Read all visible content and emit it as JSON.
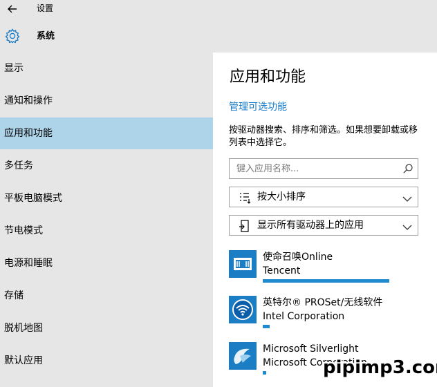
{
  "header": {
    "back_icon": "back-arrow-icon",
    "app_title": "设置",
    "section_icon": "gear-icon",
    "section_title": "系统"
  },
  "sidebar": {
    "selected_index": 2,
    "items": [
      {
        "label": "显示"
      },
      {
        "label": "通知和操作"
      },
      {
        "label": "应用和功能"
      },
      {
        "label": "多任务"
      },
      {
        "label": "平板电脑模式"
      },
      {
        "label": "节电模式"
      },
      {
        "label": "电源和睡眠"
      },
      {
        "label": "存储"
      },
      {
        "label": "脱机地图"
      },
      {
        "label": "默认应用"
      }
    ]
  },
  "main": {
    "title": "应用和功能",
    "manage_link": "管理可选功能",
    "description_line1": "按驱动器搜索、排序和筛选。如果想要卸载或移",
    "description_line2": "列表中选择它。",
    "search": {
      "placeholder": "键入应用名称..."
    },
    "sort": {
      "label": "按大小排序"
    },
    "filter": {
      "label": "显示所有驱动器上的应用"
    },
    "accent_color": "#1278c8",
    "apps": [
      {
        "name": "使命召唤Online",
        "publisher": "Tencent",
        "size_fraction": 1.0
      },
      {
        "name": "英特尔® PROSet/无线软件",
        "publisher": "Intel Corporation",
        "size_fraction": 0.055
      },
      {
        "name": "Microsoft Silverlight",
        "publisher": "Microsoft Corporation",
        "size_fraction": 0.03
      }
    ]
  },
  "watermark": "pipimp3.com"
}
